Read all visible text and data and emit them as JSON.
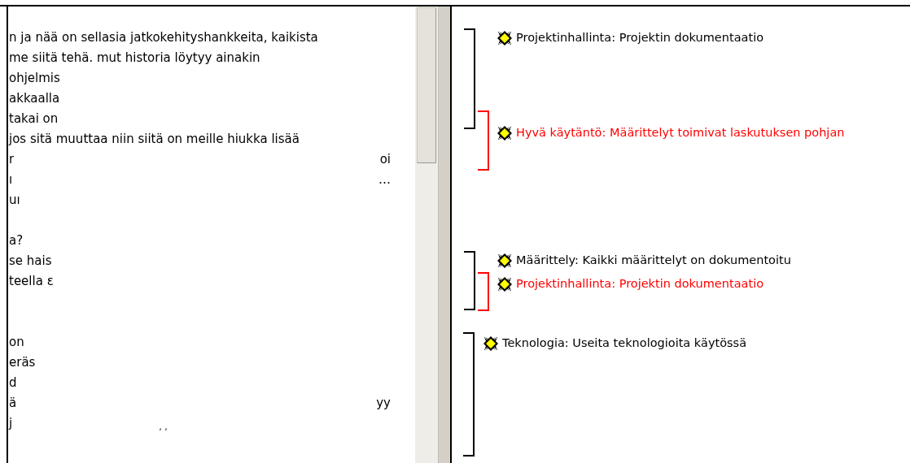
{
  "transcript": {
    "lines": [
      {
        "text": "n ja nää on sellasia jatkokehityshankkeita, kaikista"
      },
      {
        "text": "me siitä tehä. mut historia löytyy ainakin"
      },
      {
        "text": "ohjelmis"
      },
      {
        "text": "akkaalla"
      },
      {
        "text": "takai on"
      },
      {
        "text": "jos sitä muuttaa niin siitä on meille hiukka lisää"
      },
      {
        "text": "r",
        "right_text": "oi"
      },
      {
        "text": "ı",
        "right_text": "…"
      },
      {
        "text": "uı"
      },
      {
        "text": "a?"
      },
      {
        "text": "se hais"
      },
      {
        "text": "teella ε"
      },
      {
        "text": "on"
      },
      {
        "text": "eräs"
      },
      {
        "text": "d"
      },
      {
        "text": "ä",
        "right_text": "yy"
      },
      {
        "text": "j",
        "mid_text": "‚ ‚"
      }
    ]
  },
  "annotations": [
    {
      "label": "Projektinhallinta: Projektin dokumentaatio",
      "color": "#000000"
    },
    {
      "label": "Hyvä käytäntö: Määrittelyt toimivat laskutuksen pohjan",
      "color": "#ff0000"
    },
    {
      "label": "Määrittely: Kaikki määrittelyt on dokumentoitu",
      "color": "#000000"
    },
    {
      "label": "Projektinhallinta: Projektin dokumentaatio",
      "color": "#ff0000"
    },
    {
      "label": "Teknologia: Useita teknologioita käytössä",
      "color": "#000000"
    }
  ]
}
